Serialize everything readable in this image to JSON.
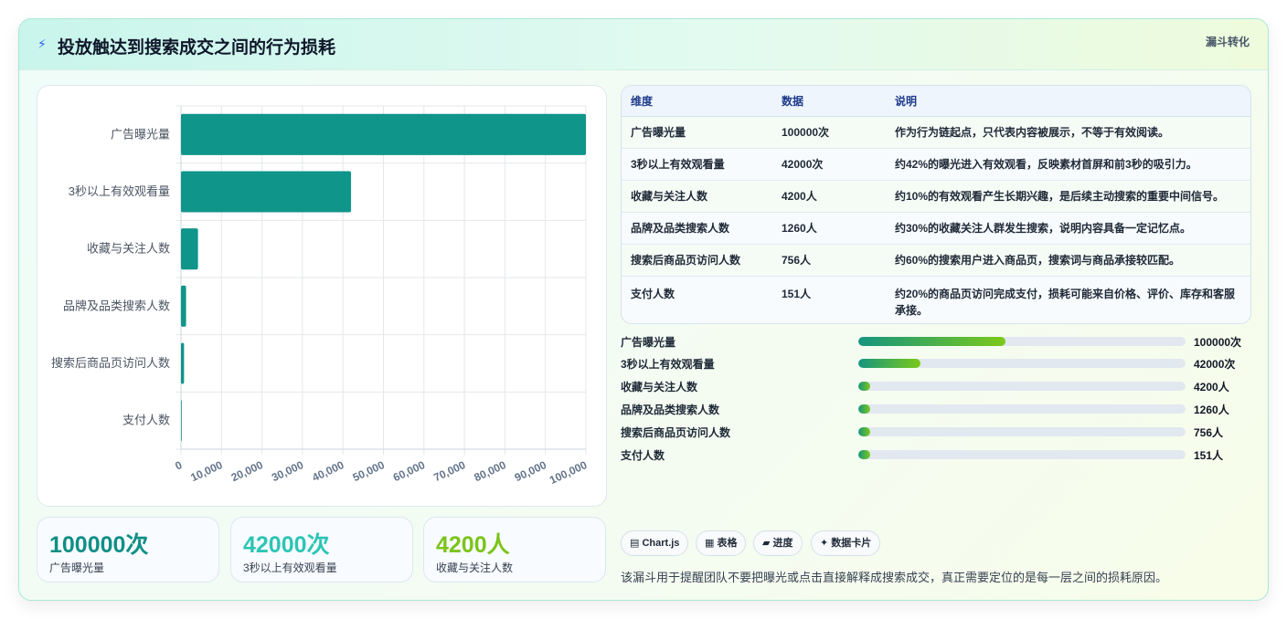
{
  "header": {
    "title": "投放触达到搜索成交之间的行为损耗",
    "tag": "漏斗转化"
  },
  "chart_data": {
    "type": "bar",
    "orientation": "horizontal",
    "categories": [
      "广告曝光量",
      "3秒以上有效观看量",
      "收藏与关注人数",
      "品牌及品类搜索人数",
      "搜索后商品页访问人数",
      "支付人数"
    ],
    "values": [
      100000,
      42000,
      4200,
      1260,
      756,
      151
    ],
    "xlim": [
      0,
      100000
    ],
    "xticks": [
      "0",
      "10,000",
      "20,000",
      "30,000",
      "40,000",
      "50,000",
      "60,000",
      "70,000",
      "80,000",
      "90,000",
      "100,000"
    ],
    "bar_color": "#10958a",
    "grid": true
  },
  "kpis": [
    {
      "value": "100000次",
      "label": "广告曝光量",
      "color": "#0f8f86"
    },
    {
      "value": "42000次",
      "label": "3秒以上有效观看量",
      "color": "#2cc5b4"
    },
    {
      "value": "4200人",
      "label": "收藏与关注人数",
      "color": "#7bc41a"
    }
  ],
  "table": {
    "headers": [
      "维度",
      "数据",
      "说明"
    ],
    "rows": [
      {
        "dim": "广告曝光量",
        "data": "100000次",
        "desc": "作为行为链起点，只代表内容被展示，不等于有效阅读。"
      },
      {
        "dim": "3秒以上有效观看量",
        "data": "42000次",
        "desc": "约42%的曝光进入有效观看，反映素材首屏和前3秒的吸引力。"
      },
      {
        "dim": "收藏与关注人数",
        "data": "4200人",
        "desc": "约10%的有效观看产生长期兴趣，是后续主动搜索的重要中间信号。"
      },
      {
        "dim": "品牌及品类搜索人数",
        "data": "1260人",
        "desc": "约30%的收藏关注人群发生搜索，说明内容具备一定记忆点。"
      },
      {
        "dim": "搜索后商品页访问人数",
        "data": "756人",
        "desc": "约60%的搜索用户进入商品页，搜索词与商品承接较匹配。"
      },
      {
        "dim": "支付人数",
        "data": "151人",
        "desc": "约20%的商品页访问完成支付，损耗可能来自价格、评价、库存和客服承接。"
      }
    ]
  },
  "progress": [
    {
      "label": "广告曝光量",
      "value": "100000次",
      "fraction": 0.45
    },
    {
      "label": "3秒以上有效观看量",
      "value": "42000次",
      "fraction": 0.19
    },
    {
      "label": "收藏与关注人数",
      "value": "4200人",
      "fraction": 0.035
    },
    {
      "label": "品牌及品类搜索人数",
      "value": "1260人",
      "fraction": 0.035
    },
    {
      "label": "搜索后商品页访问人数",
      "value": "756人",
      "fraction": 0.035
    },
    {
      "label": "支付人数",
      "value": "151人",
      "fraction": 0.035
    }
  ],
  "pills": [
    {
      "icon": "chart-icon",
      "glyph": "▤",
      "label": "Chart.js"
    },
    {
      "icon": "table-icon",
      "glyph": "▦",
      "label": "表格"
    },
    {
      "icon": "progress-icon",
      "glyph": "▰",
      "label": "进度"
    },
    {
      "icon": "sparkle-icon",
      "glyph": "✦",
      "label": "数据卡片"
    }
  ],
  "note": "该漏斗用于提醒团队不要把曝光或点击直接解释成搜索成交，真正需要定位的是每一层之间的损耗原因。"
}
